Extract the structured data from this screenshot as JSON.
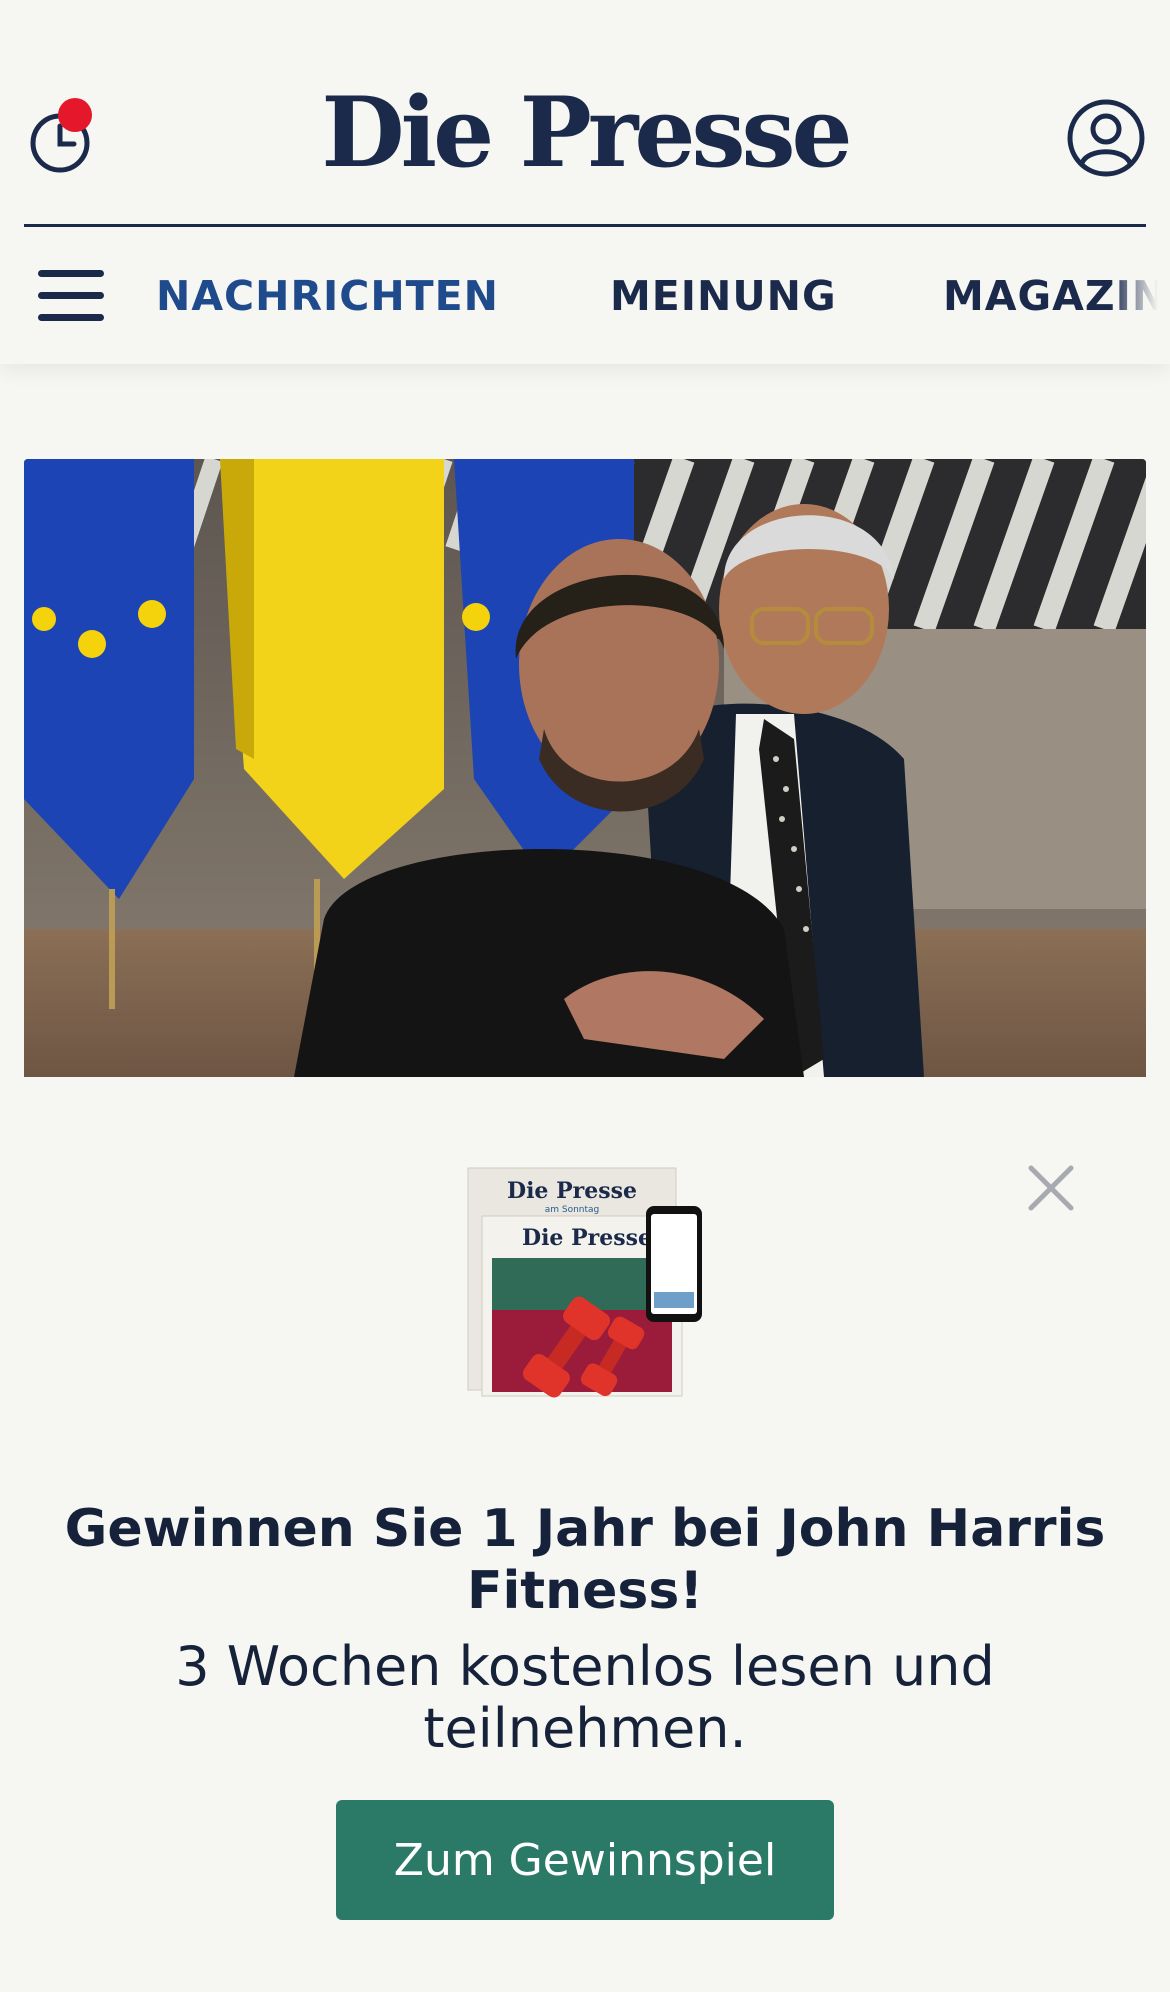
{
  "header": {
    "logo": "Die Presse",
    "history_icon": "clock-icon",
    "account_icon": "user-icon",
    "notification": true
  },
  "nav": {
    "menu_icon": "hamburger-icon",
    "items": [
      {
        "label": "NACHRICHTEN",
        "active": true
      },
      {
        "label": "MEINUNG",
        "active": false
      },
      {
        "label": "MAGAZIN",
        "active": false
      }
    ]
  },
  "hero": {
    "image": "photo-two-men-in-front-of-eu-and-ukraine-flags"
  },
  "promo": {
    "close_icon": "close-icon",
    "visual": "newspaper-and-phone-with-dumbbells-illustration",
    "visual_text": {
      "paper1_logo": "Die Presse",
      "paper1_tag": "am Sonntag",
      "paper2_logo": "Die Presse"
    },
    "title": "Gewinnen Sie 1 Jahr bei John Harris Fitness!",
    "subtitle": "3 Wochen kostenlos lesen und teilnehmen.",
    "cta_label": "Zum Gewinnspiel"
  },
  "colors": {
    "background": "#f6f6f2",
    "brand_navy": "#1b2a4a",
    "nav_active": "#1f4a8c",
    "notification": "#e4182a",
    "cta": "#2a7a67"
  }
}
